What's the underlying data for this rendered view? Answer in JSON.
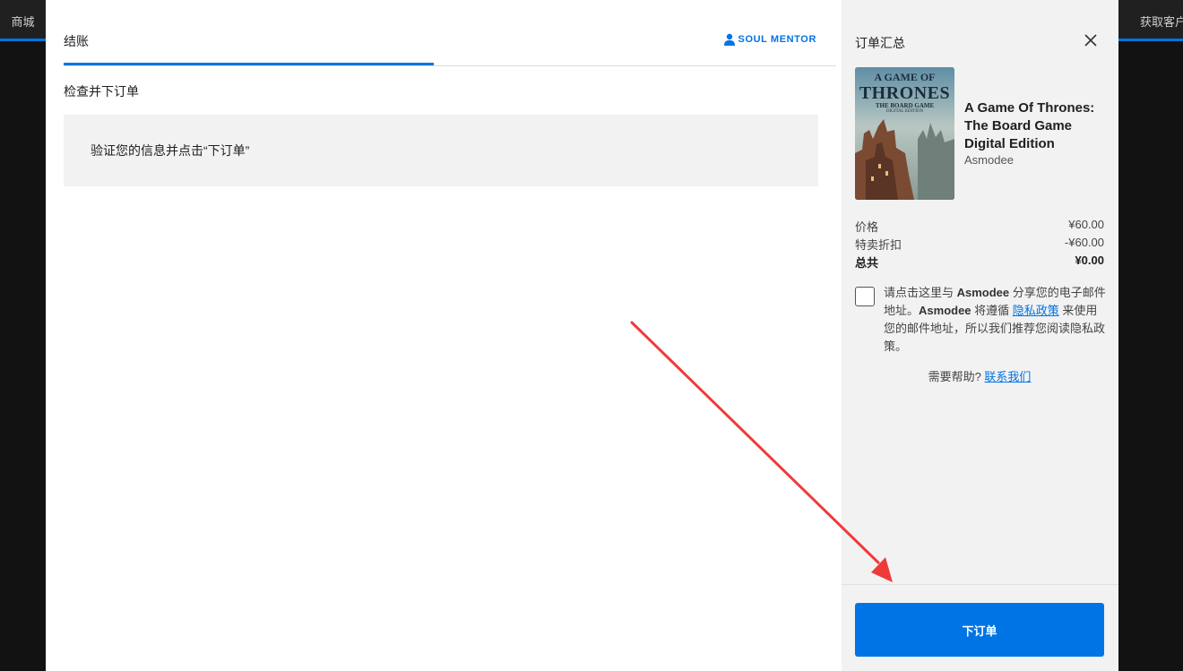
{
  "background": {
    "store_tab": "商城",
    "get_client": "获取客户端"
  },
  "checkout": {
    "tab_label": "结账",
    "user_name": "SOUL MENTOR",
    "section_title": "检查并下订单",
    "info_message": "验证您的信息并点击“下订单”"
  },
  "summary": {
    "title": "订单汇总",
    "product": {
      "name_lines": [
        "A Game Of Thrones:",
        "The Board Game",
        "Digital Edition"
      ],
      "publisher": "Asmodee",
      "cover_text": {
        "top_line": "A GAME OF",
        "main": "THRONES",
        "sub": "THE BOARD GAME",
        "edition": "DIGITAL EDITION"
      }
    },
    "price_rows": [
      {
        "label": "价格",
        "value": "¥60.00"
      },
      {
        "label": "特卖折扣",
        "value": "-¥60.00"
      },
      {
        "label": "总共",
        "value": "¥0.00"
      }
    ],
    "consent": {
      "part1": "请点击这里与 ",
      "brand1": "Asmodee",
      "part2": " 分享您的电子邮件地址。",
      "brand2": "Asmodee",
      "part3": " 将遵循 ",
      "privacy_link": "隐私政策",
      "part4": " 来使用您的邮件地址，所以我们推荐您阅读隐私政策。"
    },
    "help": {
      "text": "需要帮助? ",
      "link": "联系我们"
    },
    "place_order_label": "下订单"
  },
  "colors": {
    "accent": "#0074e4",
    "annotation_arrow": "#f03a3a",
    "summary_bg": "#f2f2f2"
  }
}
